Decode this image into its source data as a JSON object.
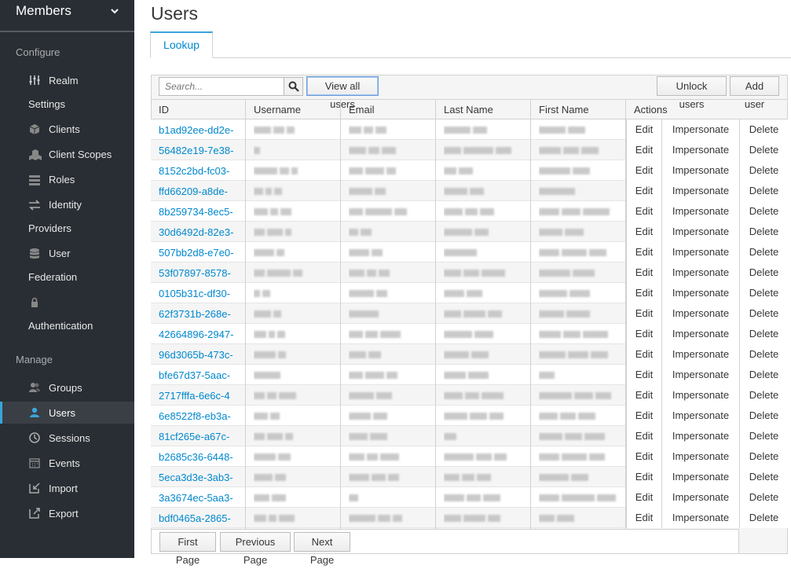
{
  "sidebar": {
    "realm": "Members",
    "configure_heading": "Configure",
    "manage_heading": "Manage",
    "configure_items": [
      {
        "label": "Realm",
        "label2": "Settings",
        "icon": "sliders-icon"
      },
      {
        "label": "Clients",
        "icon": "cube-icon"
      },
      {
        "label": "Client Scopes",
        "icon": "cubes-icon"
      },
      {
        "label": "Roles",
        "icon": "list-icon"
      },
      {
        "label": "Identity",
        "label2": "Providers",
        "icon": "exchange-icon"
      },
      {
        "label": "User",
        "label2": "Federation",
        "icon": "database-icon"
      },
      {
        "label": "",
        "label2": "Authentication",
        "icon": "lock-icon"
      }
    ],
    "manage_items": [
      {
        "label": "Groups",
        "icon": "users-icon"
      },
      {
        "label": "Users",
        "icon": "user-icon",
        "active": true
      },
      {
        "label": "Sessions",
        "icon": "clock-icon"
      },
      {
        "label": "Events",
        "icon": "calendar-icon"
      },
      {
        "label": "Import",
        "icon": "import-icon"
      },
      {
        "label": "Export",
        "icon": "export-icon"
      }
    ]
  },
  "page": {
    "title": "Users",
    "tab": "Lookup"
  },
  "toolbar": {
    "search_placeholder": "Search...",
    "view_all": "View all users",
    "unlock": "Unlock users",
    "add": "Add user"
  },
  "table": {
    "columns": [
      "ID",
      "Username",
      "Email",
      "Last Name",
      "First Name",
      "Actions"
    ],
    "actions": [
      "Edit",
      "Impersonate",
      "Delete"
    ],
    "ids": [
      "b1ad92ee-dd2e-",
      "56482e19-7e38-",
      "8152c2bd-fc03-",
      "ffd66209-a8de-",
      "8b259734-8ec5-",
      "30d6492d-82e3-",
      "507bb2d8-e7e0-",
      "53f07897-8578-",
      "0105b31c-df30-",
      "62f3731b-268e-",
      "42664896-2947-",
      "96d3065b-473c-",
      "bfe67d37-5aac-",
      "2717fffa-6e6c-4",
      "6e8522f8-eb3a-",
      "81cf265e-a67c-",
      "b2685c36-6448-",
      "5eca3d3e-3ab3-",
      "3a3674ec-5aa3-",
      "bdf0465a-2865-"
    ]
  },
  "pager": {
    "first": "First Page",
    "previous": "Previous Page",
    "next": "Next Page"
  },
  "colors": {
    "sidebar_bg": "#292e34",
    "link": "#0088ce",
    "accent": "#39a5dc"
  }
}
